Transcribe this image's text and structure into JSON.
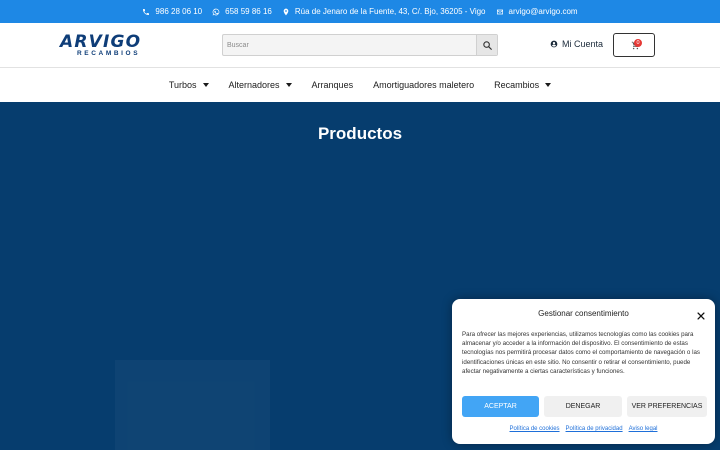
{
  "topbar": {
    "phone1": "986 28 06 10",
    "phone2": "658 59 86 16",
    "address": "Rúa de Jenaro de la Fuente, 43, C/. Bjo, 36205 - Vigo",
    "email": "arvigo@arvigo.com",
    "icons": [
      "phone-icon",
      "whatsapp-icon",
      "map-pin-icon",
      "envelope-icon"
    ]
  },
  "header": {
    "logo_word": "ARVIGO",
    "logo_sub": "RECAMBIOS",
    "search_placeholder": "Buscar",
    "account_label": "Mi Cuenta",
    "cart_count": "0"
  },
  "nav": {
    "items": [
      {
        "label": "Turbos",
        "has_dropdown": true
      },
      {
        "label": "Alternadores",
        "has_dropdown": true
      },
      {
        "label": "Arranques",
        "has_dropdown": false
      },
      {
        "label": "Amortiguadores maletero",
        "has_dropdown": false
      },
      {
        "label": "Recambios",
        "has_dropdown": true
      }
    ]
  },
  "hero": {
    "title": "Productos",
    "background": "#063d6e"
  },
  "cookie": {
    "title": "Gestionar consentimiento",
    "text": "Para ofrecer las mejores experiencias, utilizamos tecnologías como las cookies para almacenar y/o acceder a la información del dispositivo. El consentimiento de estas tecnologías nos permitirá procesar datos como el comportamiento de navegación o las identificaciones únicas en este sitio. No consentir o retirar el consentimiento, puede afectar negativamente a ciertas características y funciones.",
    "accept": "ACEPTAR",
    "deny": "DENEGAR",
    "prefs": "VER PREFERENCIAS",
    "link_cookies": "Política de cookies",
    "link_privacy": "Política de privacidad",
    "link_legal": "Aviso legal"
  },
  "colors": {
    "topbar": "#1e88e5",
    "brand": "#0e3d78",
    "accept": "#42a5f5"
  }
}
